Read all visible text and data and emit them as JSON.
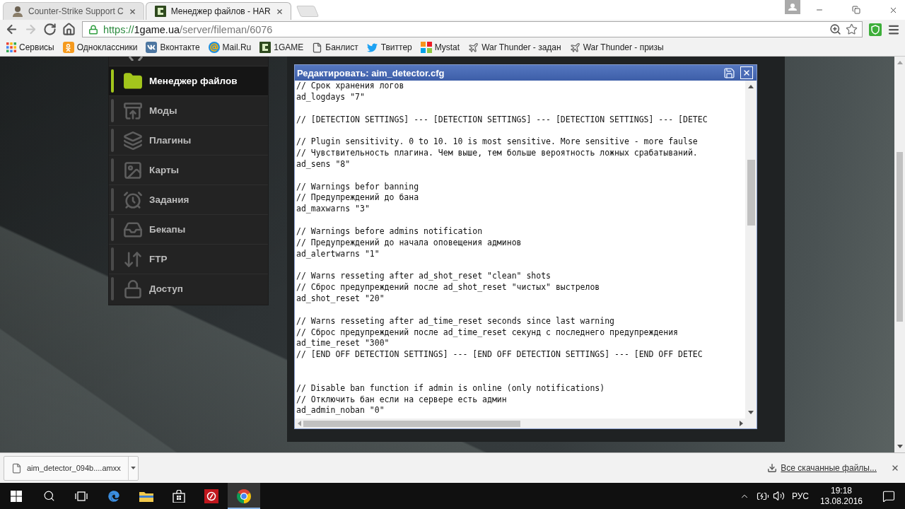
{
  "browser": {
    "tabs": [
      {
        "title": "Counter-Strike Support C",
        "selected": false
      },
      {
        "title": "Менеджер файлов - HAR",
        "selected": true
      }
    ],
    "nav_buttons": [
      {
        "disabled": false
      },
      {
        "disabled": true
      },
      {
        "disabled": false
      },
      {
        "disabled": false
      }
    ],
    "address": {
      "scheme": "https://",
      "host": "1game.ua",
      "path": "/server/fileman/6076"
    },
    "bookmarks": [
      {
        "label": "Сервисы"
      },
      {
        "label": "Одноклассники"
      },
      {
        "label": "Вконтакте"
      },
      {
        "label": "Mail.Ru"
      },
      {
        "label": "1GAME"
      },
      {
        "label": "Банлист"
      },
      {
        "label": "Твиттер"
      },
      {
        "label": "Mystat"
      },
      {
        "label": "War Thunder - задан"
      },
      {
        "label": "War Thunder - призы"
      }
    ]
  },
  "sidebar": {
    "items": [
      {
        "label": "Менеджер файлов",
        "selected": true
      },
      {
        "label": "Моды",
        "selected": false
      },
      {
        "label": "Плагины",
        "selected": false
      },
      {
        "label": "Карты",
        "selected": false
      },
      {
        "label": "Задания",
        "selected": false
      },
      {
        "label": "Бекапы",
        "selected": false
      },
      {
        "label": "FTP",
        "selected": false
      },
      {
        "label": "Доступ",
        "selected": false
      }
    ]
  },
  "editor": {
    "title": "Редактировать: aim_detector.cfg",
    "lines": [
      {
        "kind": "code",
        "text": "// Срок хранения логов"
      },
      {
        "kind": "code",
        "text": "ad_logdays \"7\""
      },
      {
        "kind": "blank"
      },
      {
        "kind": "code",
        "text": "// [DETECTION SETTINGS] --- [DETECTION SETTINGS] --- [DETECTION SETTINGS] --- [DETEC"
      },
      {
        "kind": "blank"
      },
      {
        "kind": "code",
        "text": "// Plugin sensitivity. 0 to 10. 10 is most sensitive. More sensitive - more faulse"
      },
      {
        "kind": "code",
        "text": "// Чувствительность плагина. Чем выше, тем больше вероятность ложных срабатываний."
      },
      {
        "kind": "code",
        "text": "ad_sens \"8\""
      },
      {
        "kind": "blank"
      },
      {
        "kind": "code",
        "text": "// Warnings befor banning"
      },
      {
        "kind": "code",
        "text": "// Предупреждений до бана"
      },
      {
        "kind": "code",
        "text": "ad_maxwarns \"3\""
      },
      {
        "kind": "blank"
      },
      {
        "kind": "code",
        "text": "// Warnings before admins notification"
      },
      {
        "kind": "code",
        "text": "// Предупреждений до начала оповещения админов"
      },
      {
        "kind": "code",
        "text": "ad_alertwarns \"1\""
      },
      {
        "kind": "blank"
      },
      {
        "kind": "code",
        "text": "// Warns resseting after ad_shot_reset \"clean\" shots"
      },
      {
        "kind": "code",
        "text": "// Сброс предупреждений после ad_shot_reset \"чистых\" выстрелов"
      },
      {
        "kind": "code",
        "text": "ad_shot_reset \"20\""
      },
      {
        "kind": "blank"
      },
      {
        "kind": "code",
        "text": "// Warns resseting after ad_time_reset seconds since last warning"
      },
      {
        "kind": "code",
        "text": "// Сброс предупреждений после ad_time_reset секунд с последнего предупреждения"
      },
      {
        "kind": "code",
        "text": "ad_time_reset \"300\""
      },
      {
        "kind": "code",
        "text": "// [END OFF DETECTION SETTINGS] --- [END OFF DETECTION SETTINGS] --- [END OFF DETEC"
      },
      {
        "kind": "blank"
      },
      {
        "kind": "blank"
      },
      {
        "kind": "code",
        "text": "// Disable ban function if admin is online (only notifications)"
      },
      {
        "kind": "code",
        "text": "// Отключить бан если на сервере есть админ"
      },
      {
        "kind": "code",
        "text": "ad_admin_noban \"0\""
      }
    ]
  },
  "downloads": {
    "file": "aim_detector_094b....amxx",
    "show_all": "Все скачанные файлы..."
  },
  "taskbar": {
    "apps": [
      {
        "selected": false
      },
      {
        "selected": false
      },
      {
        "selected": false
      },
      {
        "selected": false
      },
      {
        "selected": true
      }
    ],
    "language": "РУС",
    "time": "19:18",
    "date": "13.08.2016"
  }
}
